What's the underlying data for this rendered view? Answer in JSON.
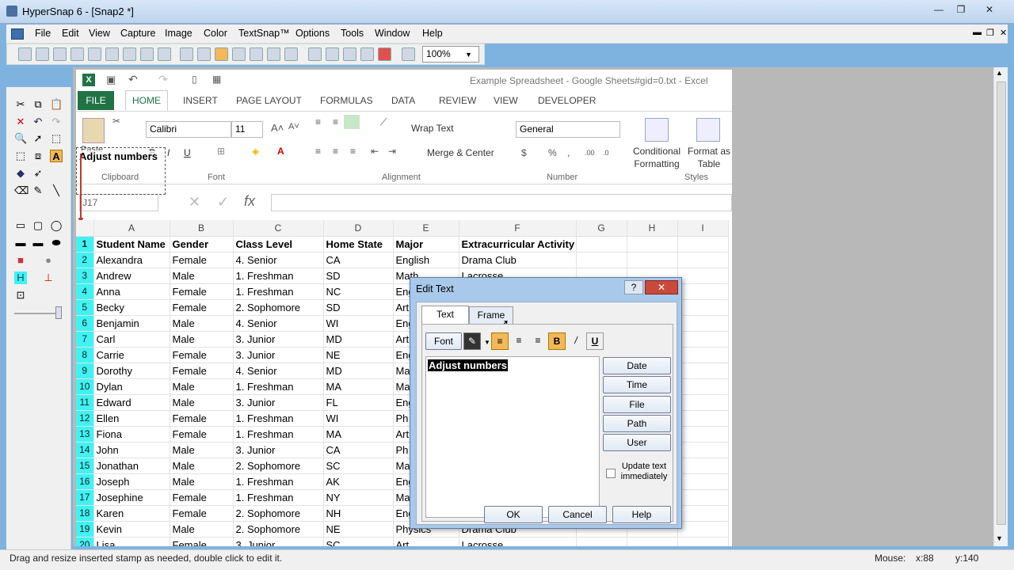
{
  "app": {
    "title": "HyperSnap 6 - [Snap2 *]"
  },
  "menu": [
    "File",
    "Edit",
    "View",
    "Capture",
    "Image",
    "Color",
    "TextSnap™",
    "Options",
    "Tools",
    "Window",
    "Help"
  ],
  "toolbar": {
    "zoom": "100%"
  },
  "stamp": {
    "text": "Adjust numbers"
  },
  "excel": {
    "title": "Example Spreadsheet - Google Sheets#gid=0.txt - Excel",
    "tabs": [
      "FILE",
      "HOME",
      "INSERT",
      "PAGE LAYOUT",
      "FORMULAS",
      "DATA",
      "REVIEW",
      "VIEW",
      "DEVELOPER"
    ],
    "font_name": "Calibri",
    "font_size": "11",
    "wrap_text": "Wrap Text",
    "merge_center": "Merge & Center",
    "number_format": "General",
    "paste": "Paste",
    "groups": {
      "clipboard": "Clipboard",
      "font": "Font",
      "alignment": "Alignment",
      "number": "Number",
      "styles": "Styles"
    },
    "conditional": "Conditional Formatting",
    "format_table": "Format as Table",
    "namebox": "J17",
    "fx": "fx",
    "columns": [
      "A",
      "B",
      "C",
      "D",
      "E",
      "F",
      "G",
      "H",
      "I"
    ],
    "headers": [
      "Student Name",
      "Gender",
      "Class Level",
      "Home State",
      "Major",
      "Extracurricular Activity"
    ],
    "rows": [
      [
        "Alexandra",
        "Female",
        "4. Senior",
        "CA",
        "English",
        "Drama Club"
      ],
      [
        "Andrew",
        "Male",
        "1. Freshman",
        "SD",
        "Math",
        "Lacrosse"
      ],
      [
        "Anna",
        "Female",
        "1. Freshman",
        "NC",
        "Eng",
        ""
      ],
      [
        "Becky",
        "Female",
        "2. Sophomore",
        "SD",
        "Art",
        ""
      ],
      [
        "Benjamin",
        "Male",
        "4. Senior",
        "WI",
        "Eng",
        ""
      ],
      [
        "Carl",
        "Male",
        "3. Junior",
        "MD",
        "Art",
        ""
      ],
      [
        "Carrie",
        "Female",
        "3. Junior",
        "NE",
        "Eng",
        ""
      ],
      [
        "Dorothy",
        "Female",
        "4. Senior",
        "MD",
        "Ma",
        ""
      ],
      [
        "Dylan",
        "Male",
        "1. Freshman",
        "MA",
        "Ma",
        ""
      ],
      [
        "Edward",
        "Male",
        "3. Junior",
        "FL",
        "Eng",
        ""
      ],
      [
        "Ellen",
        "Female",
        "1. Freshman",
        "WI",
        "Ph",
        ""
      ],
      [
        "Fiona",
        "Female",
        "1. Freshman",
        "MA",
        "Art",
        ""
      ],
      [
        "John",
        "Male",
        "3. Junior",
        "CA",
        "Ph",
        ""
      ],
      [
        "Jonathan",
        "Male",
        "2. Sophomore",
        "SC",
        "Ma",
        ""
      ],
      [
        "Joseph",
        "Male",
        "1. Freshman",
        "AK",
        "Eng",
        ""
      ],
      [
        "Josephine",
        "Female",
        "1. Freshman",
        "NY",
        "Ma",
        ""
      ],
      [
        "Karen",
        "Female",
        "2. Sophomore",
        "NH",
        "Eng",
        ""
      ],
      [
        "Kevin",
        "Male",
        "2. Sophomore",
        "NE",
        "Physics",
        "Drama Club"
      ],
      [
        "Lisa",
        "Female",
        "3. Junior",
        "SC",
        "Art",
        "Lacrosse"
      ]
    ]
  },
  "dialog": {
    "title": "Edit Text",
    "tabs": [
      "Text",
      "Frame"
    ],
    "font_btn": "Font",
    "text": "Adjust numbers",
    "side_buttons": [
      "Date",
      "Time",
      "File",
      "Path",
      "User"
    ],
    "checkbox": "Update text immediately",
    "ok": "OK",
    "cancel": "Cancel",
    "help": "Help"
  },
  "status": {
    "message": "Drag and resize inserted stamp as needed, double click to edit it.",
    "mouse": "Mouse:",
    "x": "x:88",
    "y": "y:140"
  }
}
